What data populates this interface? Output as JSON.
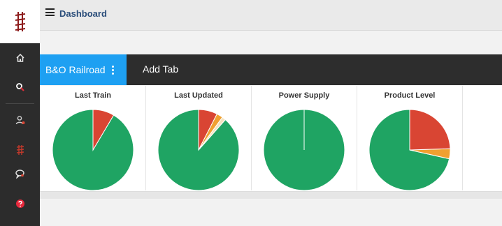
{
  "header": {
    "title": "Dashboard"
  },
  "tabs": [
    {
      "label": "B&O Railroad",
      "active": true
    },
    {
      "label": "Add Tab",
      "active": false
    }
  ],
  "sidebar": {
    "items": [
      {
        "icon": "home-icon"
      },
      {
        "icon": "search-icon"
      },
      {
        "icon": "user-icon"
      },
      {
        "icon": "railroad-icon"
      },
      {
        "icon": "chat-icon"
      },
      {
        "icon": "help-icon"
      }
    ]
  },
  "colors": {
    "green": "#1fa463",
    "red": "#d94533",
    "orange": "#f0a030",
    "accent": "#1ea0f2"
  },
  "chart_data": [
    {
      "type": "pie",
      "title": "Last Train",
      "slices": [
        {
          "value": 91.5,
          "color": "#1fa463"
        },
        {
          "value": 8.5,
          "color": "#d94533"
        }
      ]
    },
    {
      "type": "pie",
      "title": "Last Updated",
      "slices": [
        {
          "value": 88.5,
          "color": "#1fa463"
        },
        {
          "value": 1.5,
          "color": "#f3e3c0"
        },
        {
          "value": 2.5,
          "color": "#f0a030"
        },
        {
          "value": 7.5,
          "color": "#d94533"
        }
      ]
    },
    {
      "type": "pie",
      "title": "Power Supply",
      "slices": [
        {
          "value": 100,
          "color": "#1fa463"
        }
      ]
    },
    {
      "type": "pie",
      "title": "Product Level",
      "slices": [
        {
          "value": 71.5,
          "color": "#1fa463"
        },
        {
          "value": 4,
          "color": "#f0a030"
        },
        {
          "value": 24.5,
          "color": "#d94533"
        }
      ]
    }
  ]
}
